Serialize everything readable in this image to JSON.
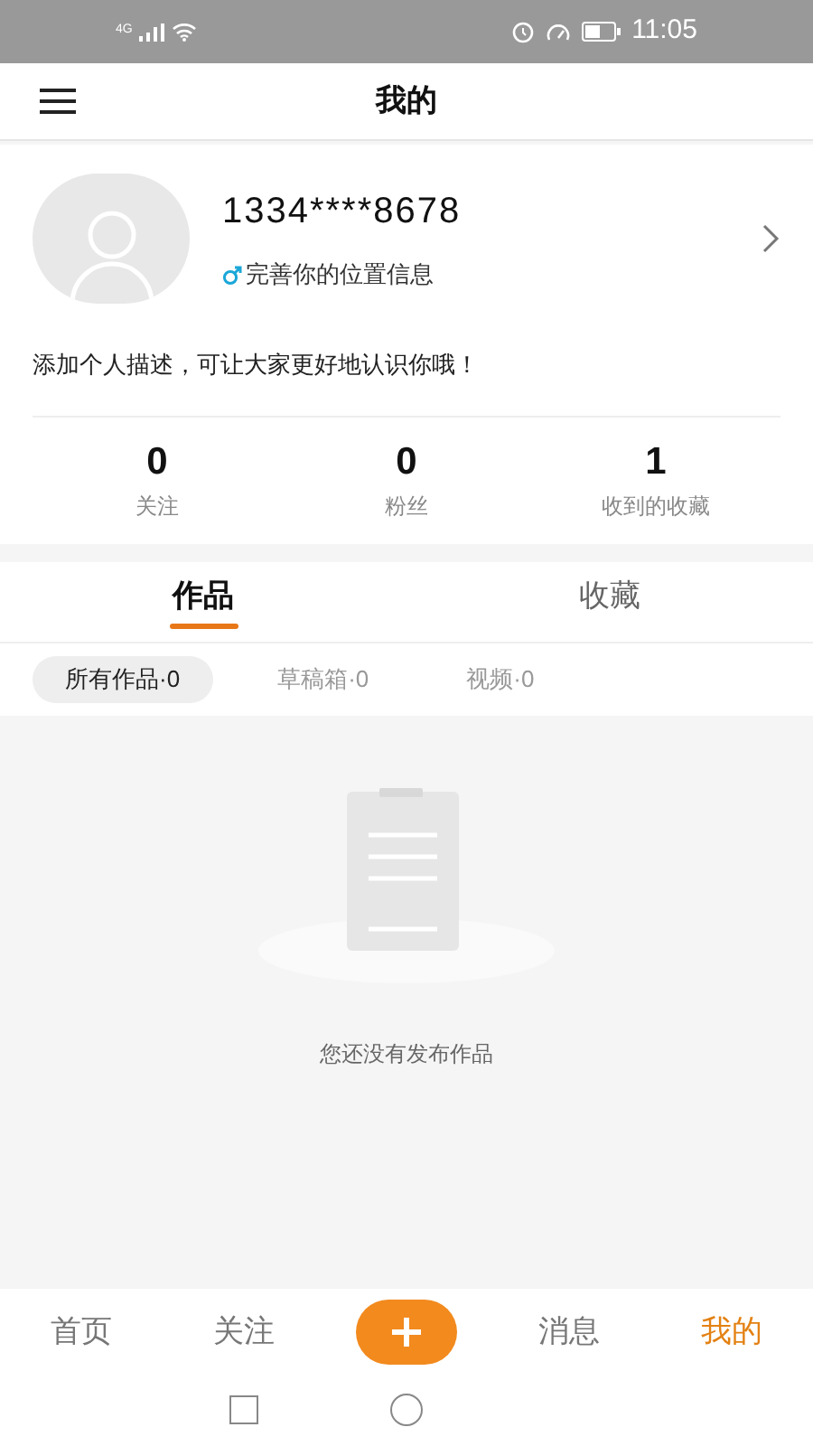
{
  "status_bar": {
    "network": "4G",
    "time": "11:05"
  },
  "header": {
    "title": "我的"
  },
  "profile": {
    "name": "1334****8678",
    "location_hint": "完善你的位置信息",
    "description": "添加个人描述，可让大家更好地认识你哦！"
  },
  "stats": [
    {
      "value": "0",
      "label": "关注"
    },
    {
      "value": "0",
      "label": "粉丝"
    },
    {
      "value": "1",
      "label": "收到的收藏"
    }
  ],
  "tabs": [
    {
      "label": "作品",
      "selected": true
    },
    {
      "label": "收藏",
      "selected": false
    }
  ],
  "filters": [
    {
      "label": "所有作品·0",
      "selected": true
    },
    {
      "label": "草稿箱·0",
      "selected": false
    },
    {
      "label": "视频·0",
      "selected": false
    }
  ],
  "empty_message": "您还没有发布作品",
  "bottom_nav": [
    {
      "kind": "text",
      "label": "首页",
      "selected": false
    },
    {
      "kind": "text",
      "label": "关注",
      "selected": false
    },
    {
      "kind": "add",
      "selected": false
    },
    {
      "kind": "text",
      "label": "消息",
      "selected": false
    },
    {
      "kind": "text",
      "label": "我的",
      "selected": true
    }
  ]
}
